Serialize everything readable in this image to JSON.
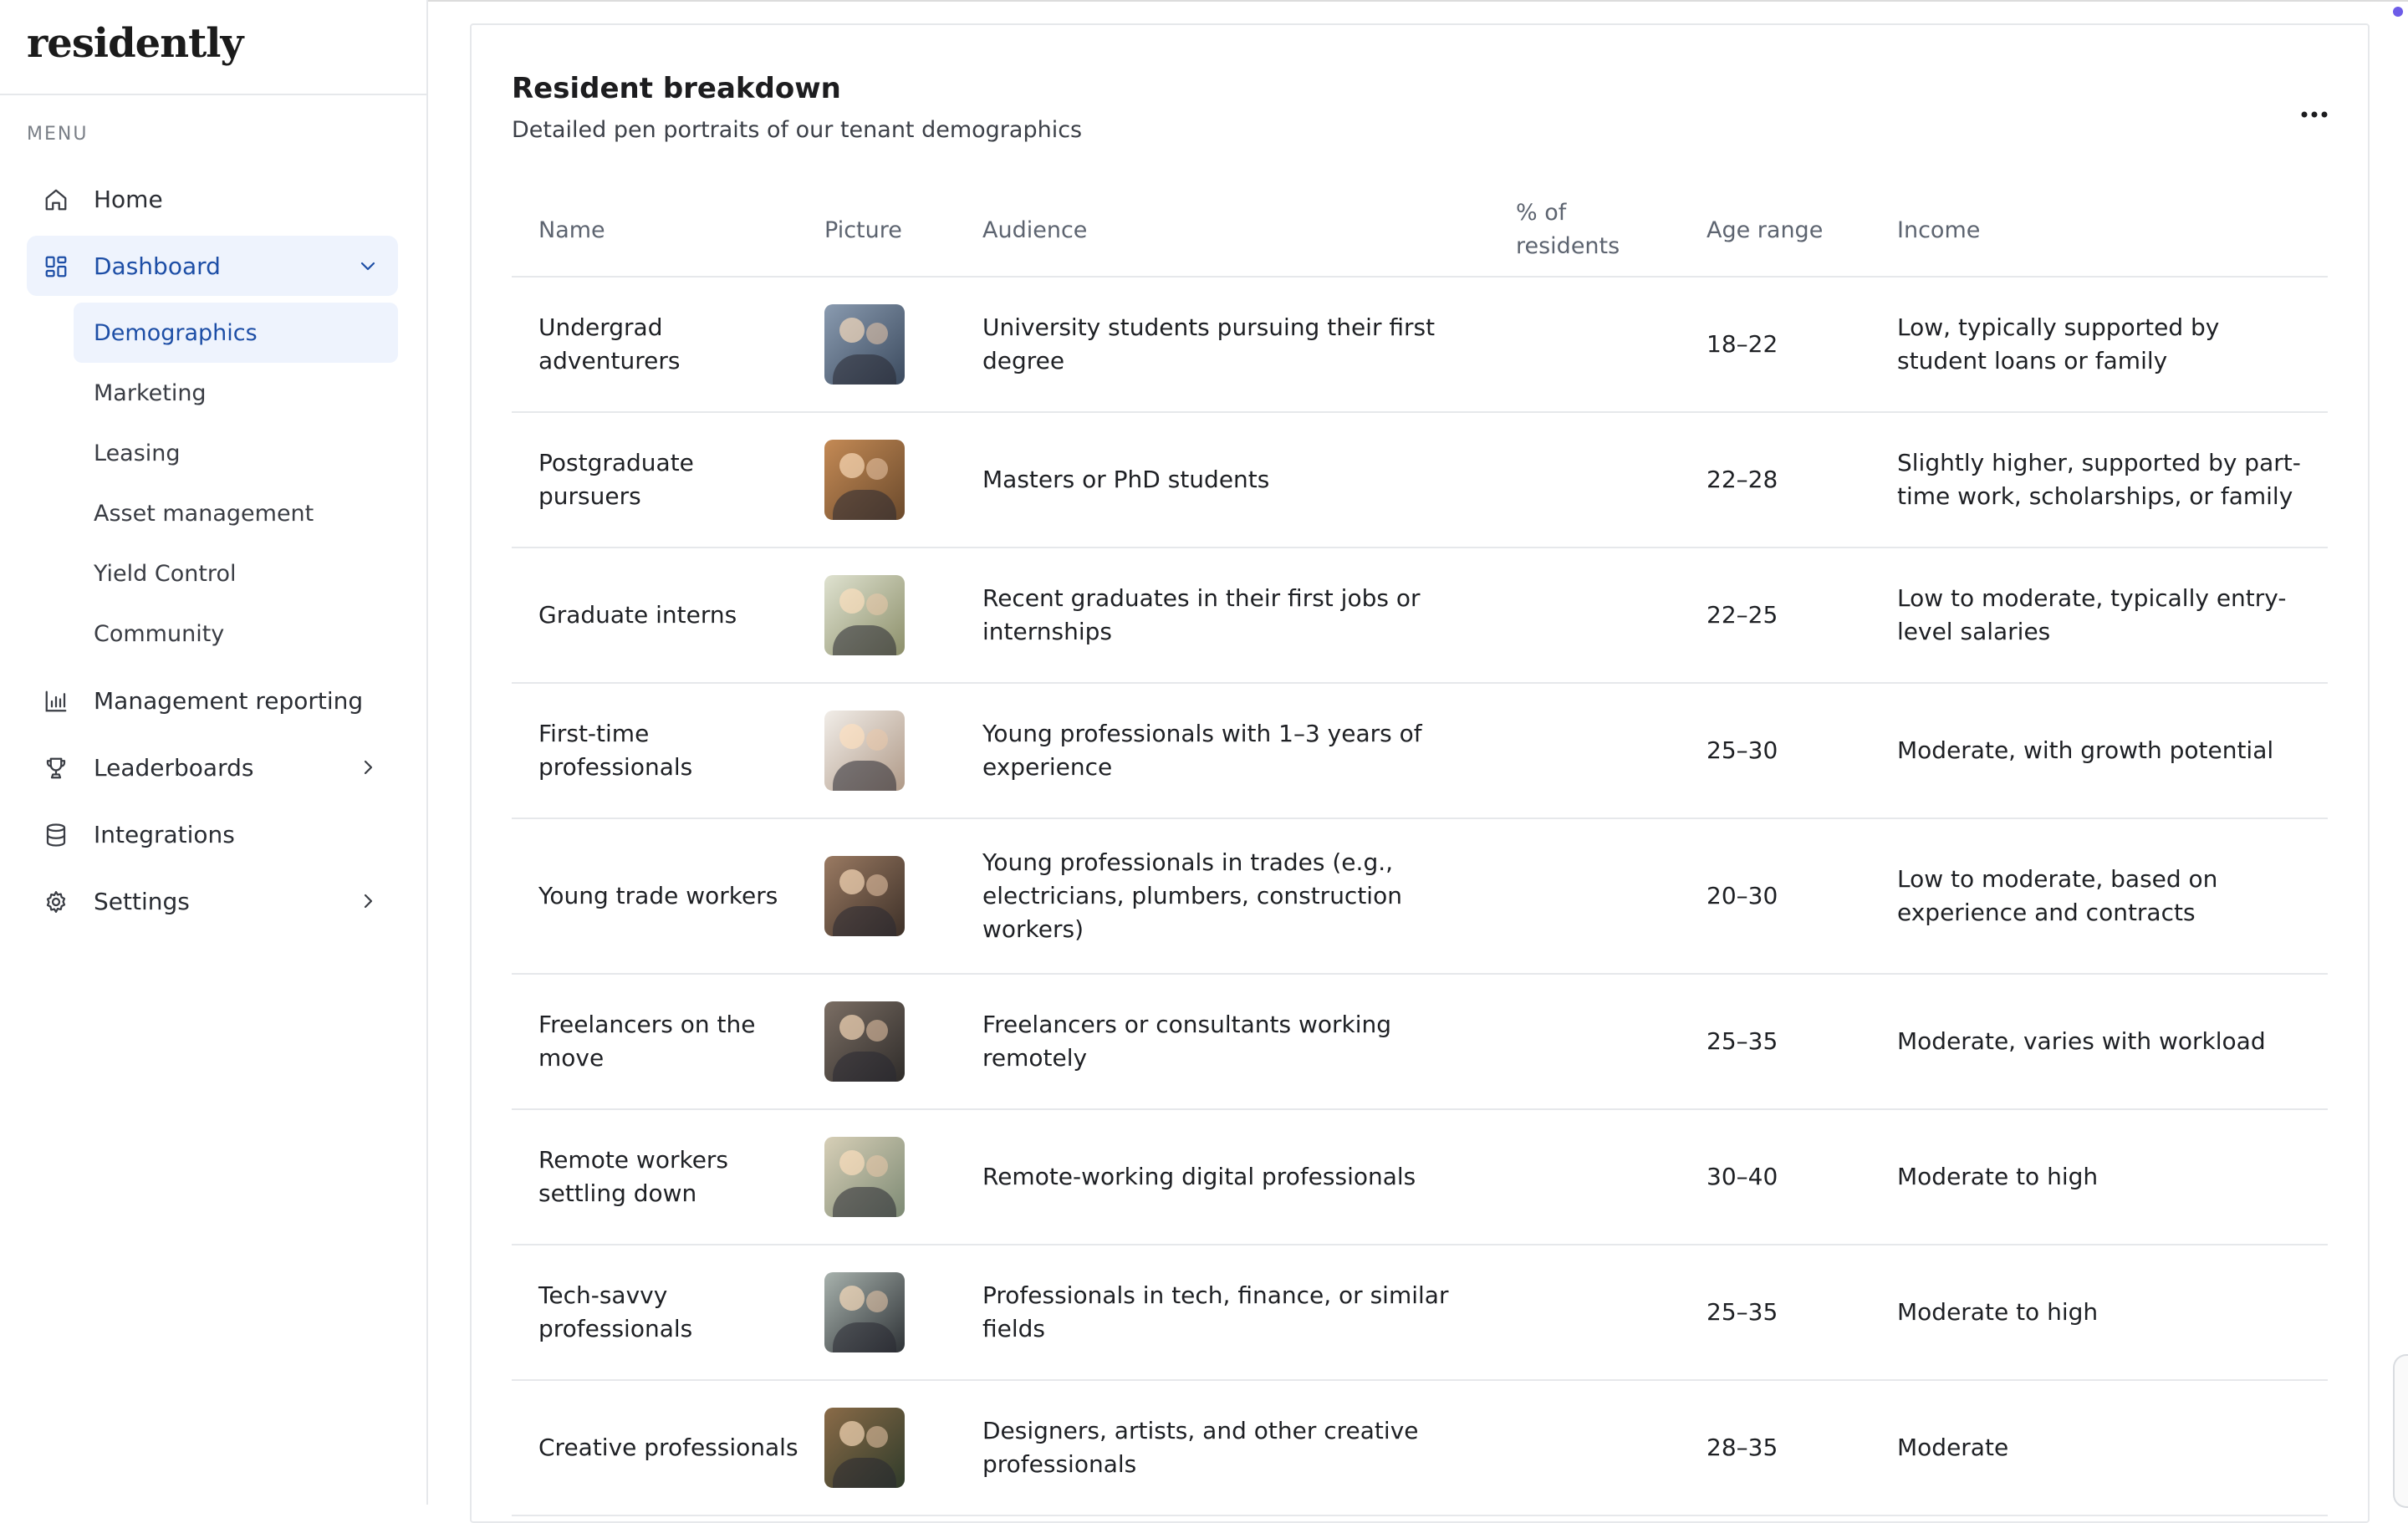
{
  "app": {
    "logo": "residently"
  },
  "sidebar": {
    "menu_label": "MENU",
    "items": [
      {
        "label": "Home",
        "icon": "home-icon"
      },
      {
        "label": "Dashboard",
        "icon": "dashboard-grid-icon"
      },
      {
        "label": "Management reporting",
        "icon": "bar-chart-icon"
      },
      {
        "label": "Leaderboards",
        "icon": "trophy-icon"
      },
      {
        "label": "Integrations",
        "icon": "database-icon"
      },
      {
        "label": "Settings",
        "icon": "gear-icon"
      }
    ],
    "dashboard_children": [
      {
        "label": "Demographics"
      },
      {
        "label": "Marketing"
      },
      {
        "label": "Leasing"
      },
      {
        "label": "Asset management"
      },
      {
        "label": "Yield Control"
      },
      {
        "label": "Community"
      }
    ]
  },
  "main": {
    "title": "Resident breakdown",
    "subtitle": "Detailed pen portraits of our tenant demographics",
    "columns": {
      "name": "Name",
      "picture": "Picture",
      "audience": "Audience",
      "percent": "% of residents",
      "age": "Age range",
      "income": "Income"
    },
    "rows": [
      {
        "name": "Undergrad adventurers",
        "audience": "University students pursuing their first degree",
        "percent": "",
        "age": "18–22",
        "income": "Low, typically supported by student loans or family",
        "tone": [
          "#3b4a5e",
          "#8a9bb0"
        ]
      },
      {
        "name": "Postgraduate pursuers",
        "audience": "Masters or PhD students",
        "percent": "",
        "age": "22–28",
        "income": "Slightly higher, supported by part-time work, scholarships, or family",
        "tone": [
          "#6b4a2c",
          "#c48a55"
        ]
      },
      {
        "name": "Graduate interns",
        "audience": "Recent graduates in their first jobs or internships",
        "percent": "",
        "age": "22–25",
        "income": "Low to moderate, typically entry-level salaries",
        "tone": [
          "#8c8f6a",
          "#dfe2d0"
        ]
      },
      {
        "name": "First-time professionals",
        "audience": "Young professionals with 1–3 years of experience",
        "percent": "",
        "age": "25–30",
        "income": "Moderate, with growth potential",
        "tone": [
          "#b09a88",
          "#f1ede8"
        ]
      },
      {
        "name": "Young trade workers",
        "audience": "Young professionals in trades (e.g., electricians, plumbers, construction workers)",
        "percent": "",
        "age": "20–30",
        "income": "Low to moderate, based on experience and contracts",
        "tone": [
          "#3d3028",
          "#9a7a62"
        ]
      },
      {
        "name": "Freelancers on the move",
        "audience": "Freelancers or consultants working remotely",
        "percent": "",
        "age": "25–35",
        "income": "Moderate, varies with workload",
        "tone": [
          "#2f2c2a",
          "#7b6e64"
        ]
      },
      {
        "name": "Remote workers settling down",
        "audience": "Remote-working digital professionals",
        "percent": "",
        "age": "30–40",
        "income": "Moderate to high",
        "tone": [
          "#7d8a74",
          "#d7cfb7"
        ]
      },
      {
        "name": "Tech-savvy professionals",
        "audience": "Professionals in tech, finance, or similar fields",
        "percent": "",
        "age": "25–35",
        "income": "Moderate to high",
        "tone": [
          "#2e3236",
          "#a8b2ad"
        ]
      },
      {
        "name": "Creative professionals",
        "audience": "Designers, artists, and other creative professionals",
        "percent": "",
        "age": "28–35",
        "income": "Moderate",
        "tone": [
          "#2f3b2a",
          "#8a6b48"
        ]
      }
    ]
  },
  "colors": {
    "accent": "#1d4ea6",
    "active_bg": "#eef3fd",
    "border": "#e6e8eb"
  }
}
